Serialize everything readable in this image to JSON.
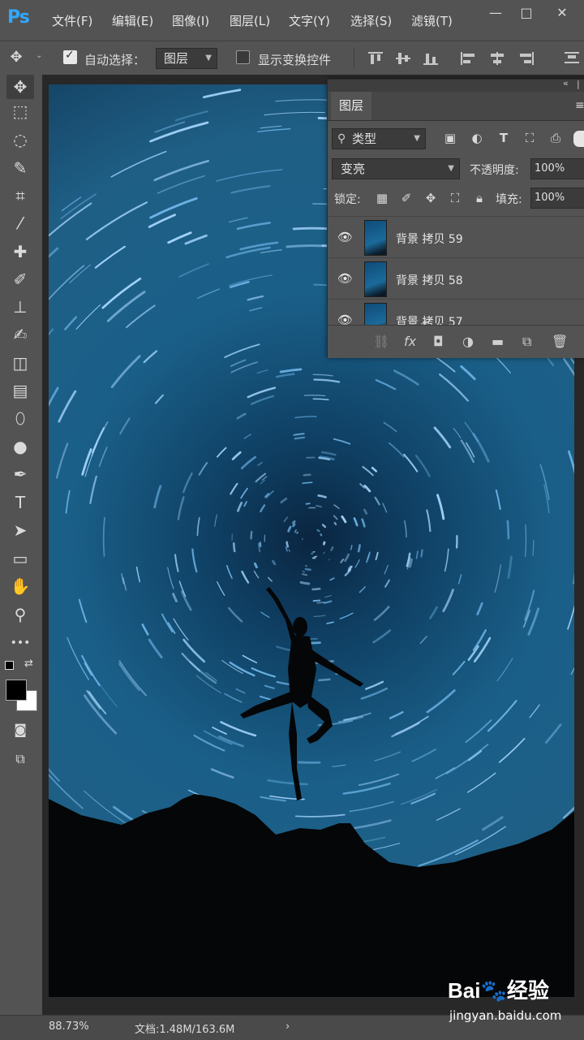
{
  "app": {
    "logo": "Ps"
  },
  "menu": [
    "文件(F)",
    "编辑(E)",
    "图像(I)",
    "图层(L)",
    "文字(Y)",
    "选择(S)",
    "滤镜(T)"
  ],
  "window_buttons": [
    "—",
    "□",
    "✕"
  ],
  "options": {
    "auto_select_label": "自动选择：",
    "auto_select_checked": true,
    "auto_select_target": "图层",
    "show_transform_label": "显示变换控件",
    "show_transform_checked": false
  },
  "toolbox": {
    "tools": [
      "move-icon",
      "marquee-icon",
      "lasso-icon",
      "quick-select-icon",
      "crop-icon",
      "eyedropper-icon",
      "healing-icon",
      "brush-icon",
      "stamp-icon",
      "history-brush-icon",
      "eraser-icon",
      "gradient-icon",
      "blur-icon",
      "dodge-icon",
      "pen-icon",
      "type-icon",
      "path-select-icon",
      "rectangle-icon",
      "hand-icon",
      "zoom-icon",
      "more-icon"
    ],
    "glyphs": [
      "✥",
      "⬚",
      "◌",
      "✎",
      "⌗",
      "⁄",
      "✚",
      "✐",
      "⊥",
      "✍",
      "◫",
      "▤",
      "⬯",
      "●",
      "✒",
      "T",
      "➤",
      "▭",
      "✋",
      "⚲",
      "•••"
    ],
    "foreground_color": "#000000",
    "background_color": "#ffffff"
  },
  "layers_panel": {
    "tab_label": "图层",
    "filter_kind": "类型",
    "blend_mode": "变亮",
    "opacity_label": "不透明度:",
    "opacity_value": "100%",
    "lock_label": "锁定:",
    "fill_label": "填充:",
    "fill_value": "100%",
    "layers": [
      {
        "name": "背景 拷贝 59",
        "visible": true
      },
      {
        "name": "背景 拷贝 58",
        "visible": true
      },
      {
        "name": "背景 拷贝 57",
        "visible": true
      }
    ]
  },
  "status": {
    "zoom": "88.73%",
    "doc_info": "文档:1.48M/163.6M"
  },
  "watermark": {
    "logo": "Bai🐾经验",
    "url": "jingyan.baidu.com"
  },
  "colors": {
    "ui_bg": "#535353",
    "sky": "#1a5f88",
    "trail": "#a8d8ff"
  }
}
